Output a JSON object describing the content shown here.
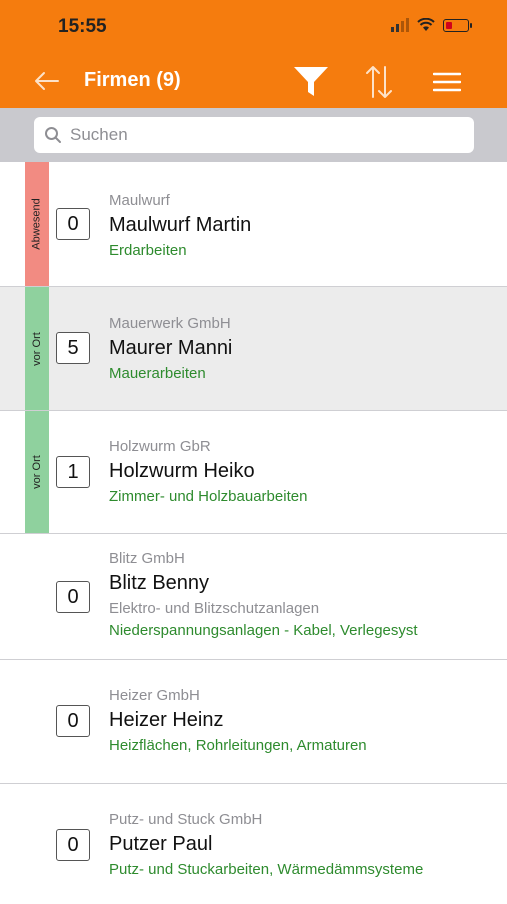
{
  "status_bar": {
    "time": "15:55"
  },
  "nav": {
    "title": "Firmen (9)",
    "back_icon": "arrow-left-icon",
    "filter_icon": "filter-icon",
    "sort_icon": "sort-icon",
    "menu_icon": "menu-icon"
  },
  "search": {
    "placeholder": "Suchen",
    "value": ""
  },
  "colors": {
    "accent": "#f57c0e",
    "absent": "#f28b82",
    "on_site": "#8fd19e",
    "trade_text": "#2e8b2e"
  },
  "rows": [
    {
      "status": "Abwesend",
      "status_color": "#f28b82",
      "count": "0",
      "company": "Maulwurf",
      "name": "Maulwurf Martin",
      "sub": "",
      "trade": "Erdarbeiten",
      "selected": false
    },
    {
      "status": "vor Ort",
      "status_color": "#8fd19e",
      "count": "5",
      "company": "Mauerwerk GmbH",
      "name": "Maurer Manni",
      "sub": "",
      "trade": "Mauerarbeiten",
      "selected": true
    },
    {
      "status": "vor Ort",
      "status_color": "#8fd19e",
      "count": "1",
      "company": "Holzwurm GbR",
      "name": "Holzwurm Heiko",
      "sub": "",
      "trade": "Zimmer- und Holzbauarbeiten",
      "selected": false
    },
    {
      "status": "",
      "status_color": "",
      "count": "0",
      "company": "Blitz GmbH",
      "name": "Blitz Benny",
      "sub": "Elektro- und Blitzschutzanlagen",
      "trade": "Niederspannungsanlagen - Kabel, Verlegesyst",
      "selected": false
    },
    {
      "status": "",
      "status_color": "",
      "count": "0",
      "company": "Heizer GmbH",
      "name": "Heizer Heinz",
      "sub": "",
      "trade": "Heizflächen, Rohrleitungen, Armaturen",
      "selected": false
    },
    {
      "status": "",
      "status_color": "",
      "count": "0",
      "company": "Putz- und Stuck GmbH",
      "name": "Putzer Paul",
      "sub": "",
      "trade": "Putz- und Stuckarbeiten, Wärmedämmsysteme",
      "selected": false
    }
  ]
}
